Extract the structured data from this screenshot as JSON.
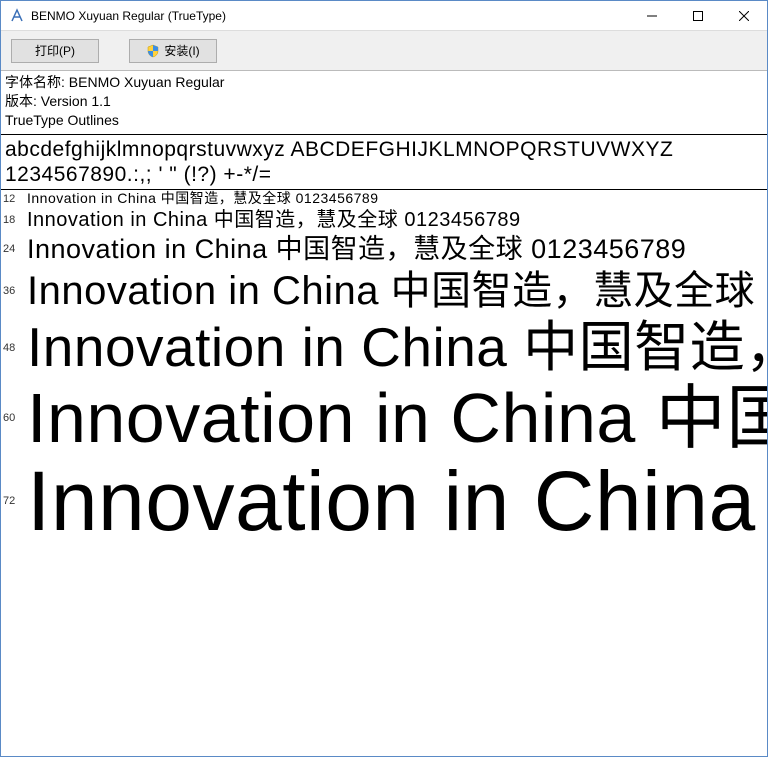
{
  "titlebar": {
    "title": "BENMO Xuyuan Regular (TrueType)"
  },
  "toolbar": {
    "print_label": "打印(P)",
    "install_label": "安装(I)"
  },
  "meta": {
    "name_line": "字体名称: BENMO Xuyuan Regular",
    "version_line": "版本: Version 1.1",
    "outlines_line": "TrueType Outlines"
  },
  "charset": {
    "line1": "abcdefghijklmnopqrstuvwxyz ABCDEFGHIJKLMNOPQRSTUVWXYZ",
    "line2": "1234567890.:,; ' \" (!?) +-*/="
  },
  "sample_text": "Innovation in China 中国智造，慧及全球 0123456789",
  "sizes": {
    "s12": "12",
    "s18": "18",
    "s24": "24",
    "s36": "36",
    "s48": "48",
    "s60": "60",
    "s72": "72"
  }
}
